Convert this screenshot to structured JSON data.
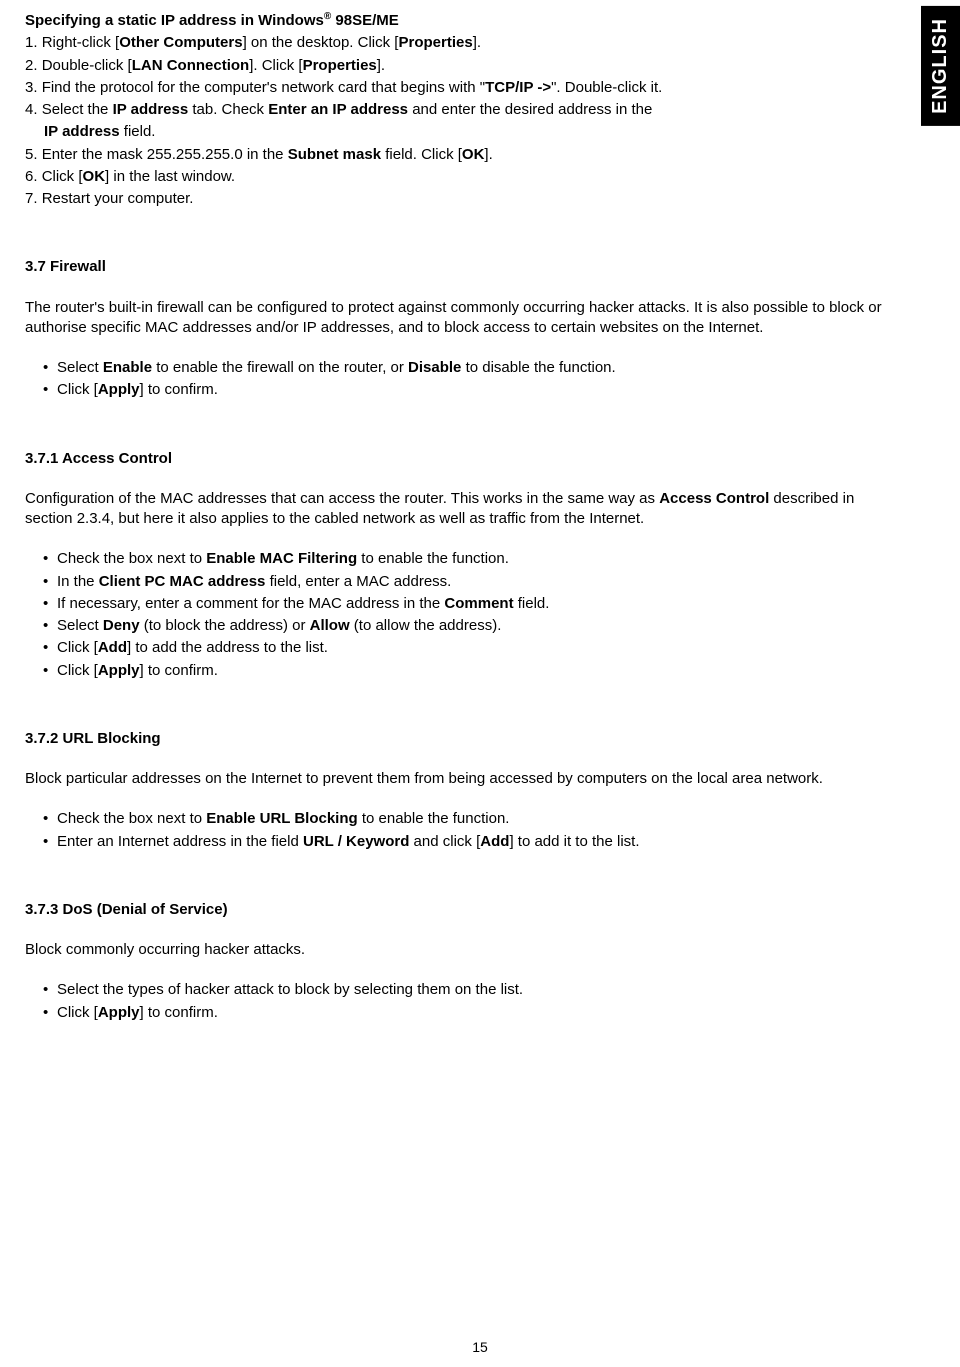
{
  "langTab": "ENGLISH",
  "pageNumber": "15",
  "h0": {
    "pre": "Specifying a static IP address in Windows",
    "sup": "®",
    "post": " 98SE/ME"
  },
  "s1": {
    "n": "1. ",
    "t1": "Right-click [",
    "b1": "Other Computers",
    "t2": "] on the desktop. Click [",
    "b2": "Properties",
    "t3": "]."
  },
  "s2": {
    "n": "2. ",
    "t1": "Double-click [",
    "b1": "LAN Connection",
    "t2": "]. Click [",
    "b2": "Properties",
    "t3": "]."
  },
  "s3": {
    "n": "3. ",
    "t1": "Find the protocol for the computer's network card that begins with \"",
    "b1": "TCP/IP ->",
    "t2": "\". Double-click it."
  },
  "s4": {
    "n": "4. ",
    "t1": "Select the ",
    "b1": "IP address",
    "t2": " tab. Check ",
    "b2": "Enter an IP address",
    "t3": " and enter the desired address in the "
  },
  "s4b": {
    "b1": "IP address",
    "t1": " field."
  },
  "s5": {
    "n": "5. ",
    "t1": "Enter the mask 255.255.255.0 in the ",
    "b1": "Subnet mask",
    "t2": " field. Click [",
    "b2": "OK",
    "t3": "]."
  },
  "s6": {
    "n": "6. ",
    "t1": "Click [",
    "b1": "OK",
    "t2": "] in the last window."
  },
  "s7": {
    "n": "7. ",
    "t1": "Restart your computer."
  },
  "sec37": {
    "title": "3.7  Firewall",
    "para": "The router's built-in firewall can be configured to protect against commonly occurring hacker attacks. It is also possible to block or authorise specific MAC addresses and/or IP addresses, and to block access to certain websites on the Internet.",
    "a1": {
      "t1": "Select ",
      "b1": "Enable",
      "t2": " to enable the firewall on the router, or ",
      "b2": "Disable",
      "t3": " to disable the function."
    },
    "a2": {
      "t1": "Click [",
      "b1": "Apply",
      "t2": "] to confirm."
    }
  },
  "sec371": {
    "title": "3.7.1  Access Control",
    "p1a": "Configuration of the MAC addresses that can access the router. This works in the same way as ",
    "p1b": "Access Control",
    "p1c": " described in section 2.3.4, but here it also applies to the cabled network as well as traffic from the Internet.",
    "b1": {
      "t1": "Check the box next to ",
      "b1": "Enable MAC Filtering",
      "t2": " to enable the function."
    },
    "b2": {
      "t1": "In the ",
      "b1": "Client PC MAC address",
      "t2": " field, enter a MAC address."
    },
    "b3": {
      "t1": "If necessary, enter a comment for the MAC address in the ",
      "b1": "Comment",
      "t2": " field."
    },
    "b4": {
      "t1": "Select ",
      "b1": "Deny",
      "t2": " (to block the address) or ",
      "b2": "Allow",
      "t3": " (to allow the address)."
    },
    "b5": {
      "t1": "Click [",
      "b1": "Add",
      "t2": "] to add the address to the list."
    },
    "b6": {
      "t1": "Click [",
      "b1": "Apply",
      "t2": "] to confirm."
    }
  },
  "sec372": {
    "title": "3.7.2  URL Blocking",
    "para": "Block particular addresses on the Internet to prevent them from being accessed by computers on the local area network.",
    "b1": {
      "t1": "Check the box next to ",
      "b1": "Enable URL Blocking",
      "t2": " to enable the function."
    },
    "b2": {
      "t1": "Enter an Internet address in the field ",
      "b1": "URL / Keyword",
      "t2": " and click [",
      "b2": "Add",
      "t3": "] to add it to the list."
    }
  },
  "sec373": {
    "title": "3.7.3 DoS (Denial of Service)",
    "para": "Block commonly occurring hacker attacks.",
    "b1": {
      "t1": "Select the types of hacker attack to block by selecting them on the list."
    },
    "b2": {
      "t1": "Click [",
      "b1": "Apply",
      "t2": "] to confirm."
    }
  }
}
